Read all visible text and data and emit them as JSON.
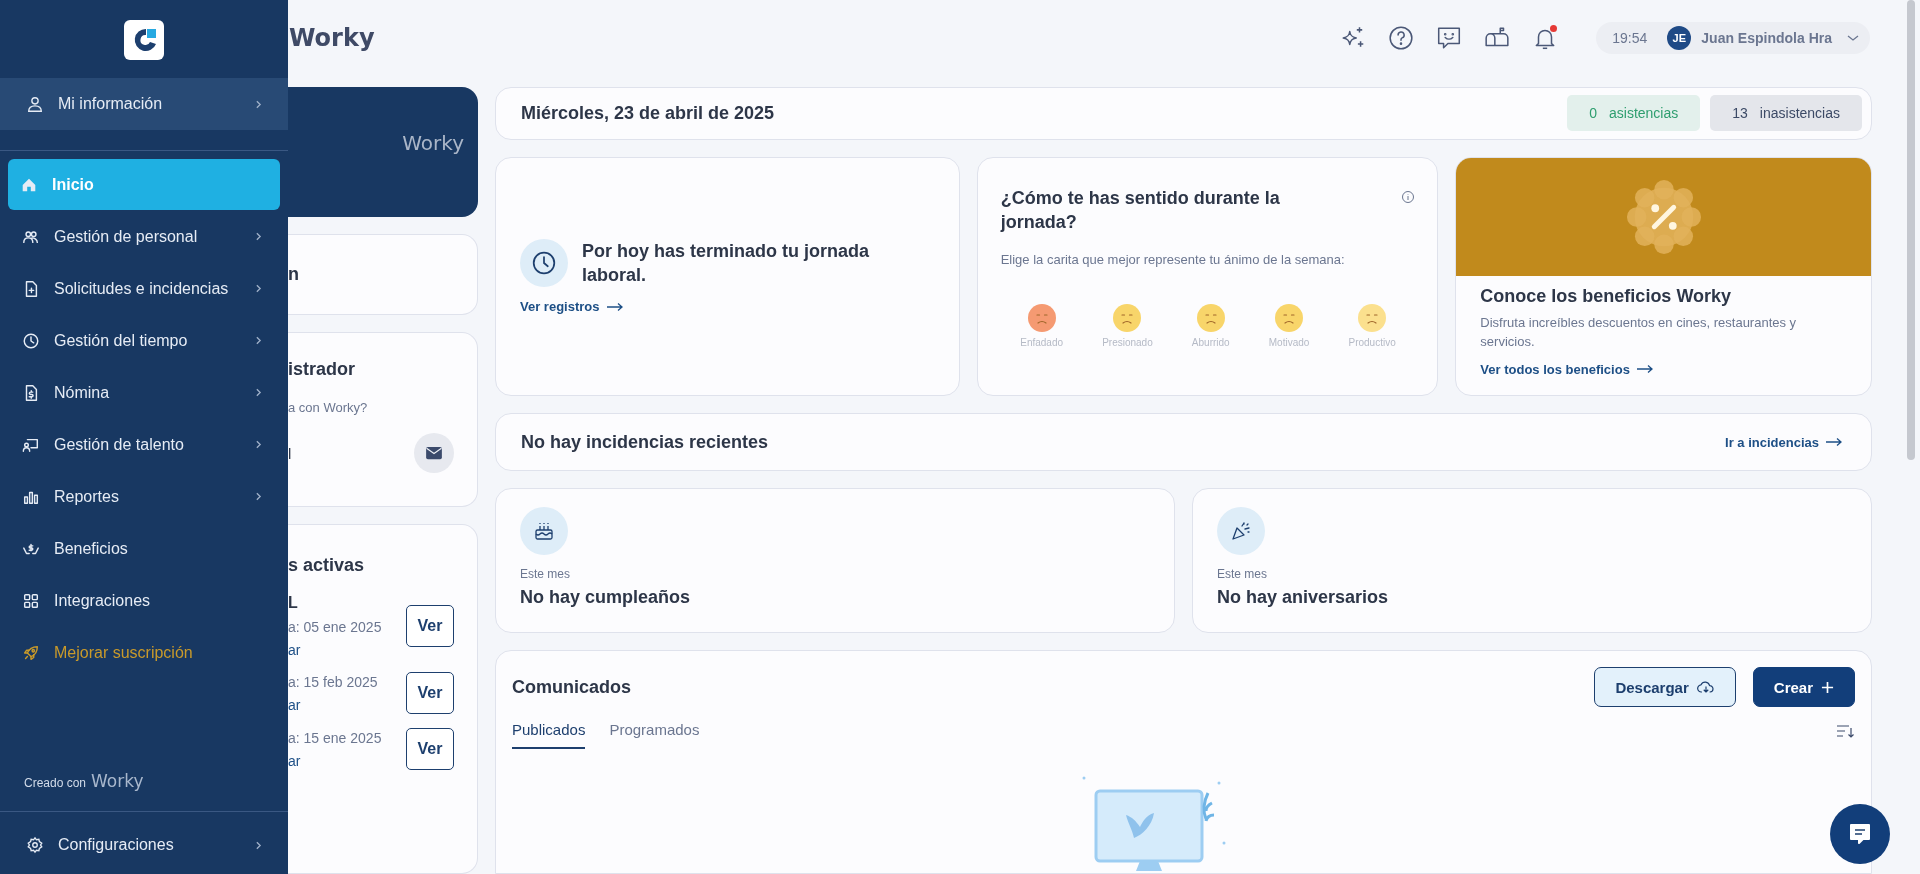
{
  "sidebar": {
    "profile_item": {
      "label": "Mi información"
    },
    "items": [
      {
        "label": "Inicio",
        "selected": true,
        "has_submenu": false,
        "kind": "nav"
      },
      {
        "label": "Gestión de personal",
        "selected": false,
        "has_submenu": true,
        "kind": "nav"
      },
      {
        "label": "Solicitudes e incidencias",
        "selected": false,
        "has_submenu": true,
        "kind": "nav"
      },
      {
        "label": "Gestión del tiempo",
        "selected": false,
        "has_submenu": true,
        "kind": "nav"
      },
      {
        "label": "Nómina",
        "selected": false,
        "has_submenu": true,
        "kind": "nav"
      },
      {
        "label": "Gestión de talento",
        "selected": false,
        "has_submenu": true,
        "kind": "nav"
      },
      {
        "label": "Reportes",
        "selected": false,
        "has_submenu": true,
        "kind": "nav"
      },
      {
        "label": "Beneficios",
        "selected": false,
        "has_submenu": false,
        "kind": "nav"
      },
      {
        "label": "Integraciones",
        "selected": false,
        "has_submenu": false,
        "kind": "nav"
      },
      {
        "label": "Mejorar suscripción",
        "selected": false,
        "has_submenu": false,
        "kind": "upgrade"
      }
    ],
    "footer": {
      "created_with": "Creado con",
      "brand": "Worky"
    },
    "settings_item": {
      "label": "Configuraciones"
    }
  },
  "header": {
    "title": "Worky",
    "time": "19:54",
    "user": {
      "initials": "JE",
      "name": "Juan Espindola Hra"
    },
    "notification_badge": true
  },
  "left_column": {
    "banner": {
      "brand": "Worky"
    },
    "card_1": {
      "title": "n"
    },
    "card_2": {
      "title": "istrador",
      "text": "a con Worky?",
      "line_3": "l"
    },
    "card_3": {
      "title": "s activas",
      "rows": [
        {
          "name": "L",
          "date": "a: 05 ene 2025",
          "link": "ar",
          "button": "Ver"
        },
        {
          "date": "a: 15 feb 2025",
          "link": "ar",
          "button": "Ver"
        },
        {
          "date": "a: 15 ene 2025",
          "link": "ar",
          "button": "Ver"
        }
      ]
    }
  },
  "date_bar": {
    "date": "Miércoles, 23 de abril de 2025",
    "badges": [
      {
        "count": "0",
        "label": "asistencias",
        "color": "#2e9e6f"
      },
      {
        "count": "13",
        "label": "inasistencias",
        "color": "#3c4a66"
      }
    ]
  },
  "workday_card": {
    "title": "Por hoy has terminado tu jornada laboral.",
    "link": "Ver registros"
  },
  "mood_card": {
    "title": "¿Cómo te has sentido durante la jornada?",
    "subtitle": "Elige la carita que mejor represente tu ánimo de la semana:",
    "faces": [
      {
        "label": "Enfadado",
        "color": "#f59a72"
      },
      {
        "label": "Presionado",
        "color": "#f8d56a"
      },
      {
        "label": "Aburrido",
        "color": "#f8d56a"
      },
      {
        "label": "Motivado",
        "color": "#f8d56a"
      },
      {
        "label": "Productivo",
        "color": "#fbe08e"
      }
    ]
  },
  "benefits_card": {
    "title": "Conoce los beneficios Worky",
    "text": "Disfruta increíbles descuentos en cines, restaurantes y servicios.",
    "link": "Ver todos los beneficios"
  },
  "incidents_bar": {
    "title": "No hay incidencias recientes",
    "link": "Ir a incidencias"
  },
  "events": [
    {
      "kind": "birthday",
      "caption": "Este mes",
      "title": "No hay cumpleaños"
    },
    {
      "kind": "anniversary",
      "caption": "Este mes",
      "title": "No hay aniversarios"
    }
  ],
  "announcements": {
    "title": "Comunicados",
    "buttons": [
      {
        "label": "Descargar",
        "kind": "secondary"
      },
      {
        "label": "Crear",
        "kind": "primary"
      }
    ],
    "tabs": [
      {
        "label": "Publicados",
        "selected": true
      },
      {
        "label": "Programados",
        "selected": false
      }
    ]
  }
}
